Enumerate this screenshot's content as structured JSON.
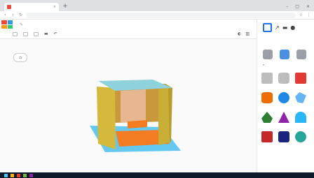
{
  "browser": {
    "tab_title": "",
    "new_tab_label": "+",
    "tab_close": "×",
    "window_controls": [
      "–",
      "□",
      "×"
    ],
    "url": ""
  },
  "tinkercad": {
    "design_title": "",
    "toolbar_icons": [
      "copy-icon",
      "paste-icon",
      "duplicate-icon",
      "trash-icon",
      "undo-icon",
      "redo-icon"
    ],
    "right_panel": {
      "view_icons": [
        "box-view-icon",
        "ruler-icon",
        "workplane-icon"
      ],
      "category_tabs": [
        "basic-shapes",
        "text",
        "connectors"
      ],
      "shapes": [
        {
          "name": "box-hole",
          "color": "#bdbdbd"
        },
        {
          "name": "cylinder-hole",
          "color": "#bdbdbd"
        },
        {
          "name": "box",
          "color": "#e53935"
        },
        {
          "name": "cylinder",
          "color": "#ef6c00"
        },
        {
          "name": "sphere",
          "color": "#1e88e5"
        },
        {
          "name": "scribble",
          "color": "#64b5f6"
        },
        {
          "name": "roof",
          "color": "#2e7d32"
        },
        {
          "name": "cone",
          "color": "#8e24aa"
        },
        {
          "name": "round-roof",
          "color": "#29b6f6"
        },
        {
          "name": "text",
          "color": "#c62828"
        },
        {
          "name": "polygon",
          "color": "#1a237e"
        },
        {
          "name": "torus",
          "color": "#26a69a"
        }
      ]
    },
    "model_colors": {
      "walls": "#d4b93d",
      "roof": "#8ed3dc",
      "floor": "#f57c22",
      "workplane": "#64c8f0",
      "backwall": "#e6b791"
    }
  }
}
